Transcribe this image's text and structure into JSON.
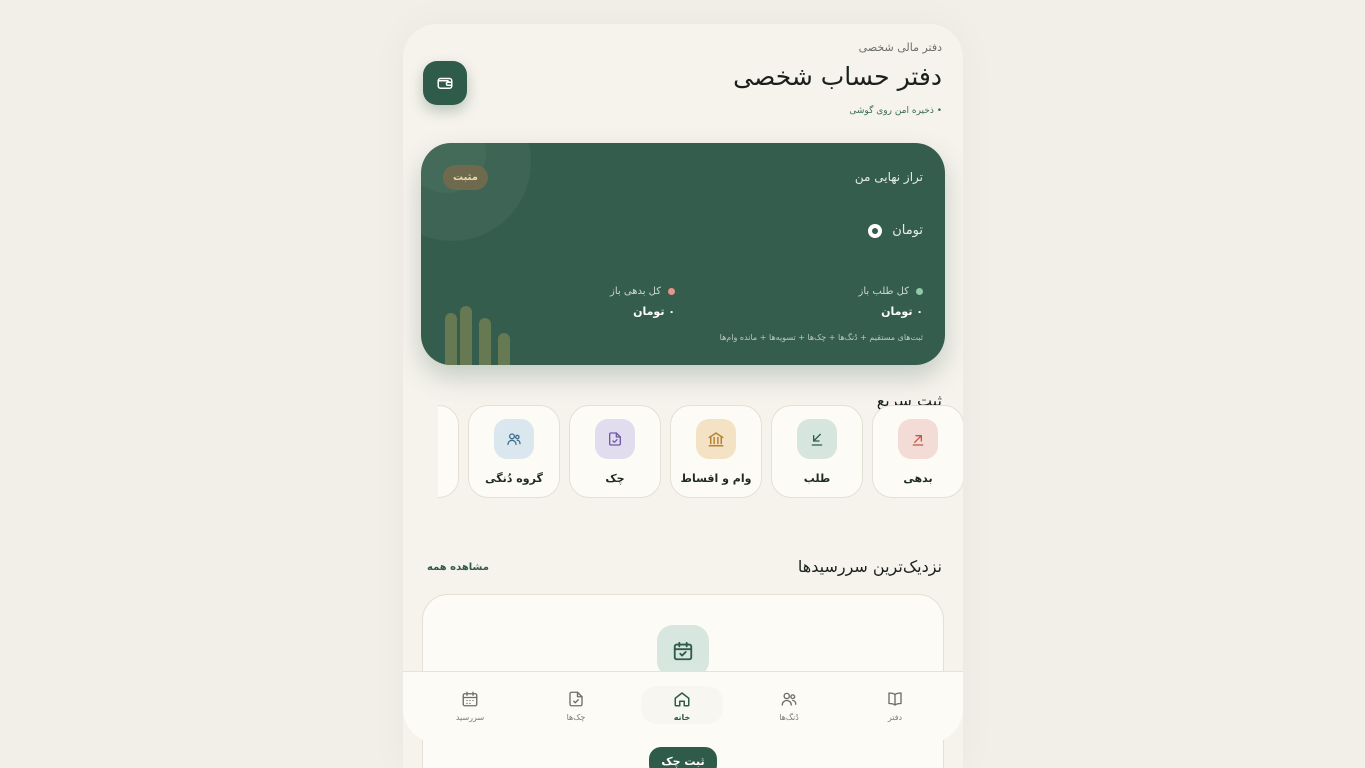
{
  "header": {
    "subtitle": "دفتر مالی شخصی",
    "title": "دفتر حساب شخصی",
    "storage_note": "• ذخیره امن روی گوشی"
  },
  "balance_card": {
    "badge": "مثبت",
    "label": "تراز نهایی من",
    "currency": "تومان",
    "receivable_label": "کل طلب باز",
    "receivable_value": "۰ تومان",
    "debt_label": "کل بدهی باز",
    "debt_value": "۰ تومان",
    "footnote": "ثبت‌های مستقیم + دُنگ‌ها + چک‌ها + تسویه‌ها + مانده وام‌ها"
  },
  "quick": {
    "title": "ثبت سریع",
    "items": [
      {
        "label": "بدهی",
        "icon": "arrow-up-right-icon"
      },
      {
        "label": "طلب",
        "icon": "arrow-down-left-icon"
      },
      {
        "label": "وام و اقساط",
        "icon": "bank-icon"
      },
      {
        "label": "چک",
        "icon": "cheque-icon"
      },
      {
        "label": "گروه دُنگی",
        "icon": "users-icon"
      }
    ]
  },
  "due": {
    "title": "نزدیک‌ترین سررسیدها",
    "see_all": "مشاهده همه"
  },
  "nav": {
    "items": [
      {
        "label": "دفتر",
        "icon": "book-icon"
      },
      {
        "label": "دُنگ‌ها",
        "icon": "users-icon"
      },
      {
        "label": "خانه",
        "icon": "home-icon"
      },
      {
        "label": "چک‌ها",
        "icon": "cheque-icon"
      },
      {
        "label": "سررسید",
        "icon": "calendar-icon"
      }
    ]
  },
  "fab_label": "ثبت چک",
  "colors": {
    "brand": "#2f5c4a",
    "card": "#355d4d",
    "background": "#f2efe8",
    "positive_dot": "#8fc9a6",
    "negative_dot": "#e6958a"
  }
}
